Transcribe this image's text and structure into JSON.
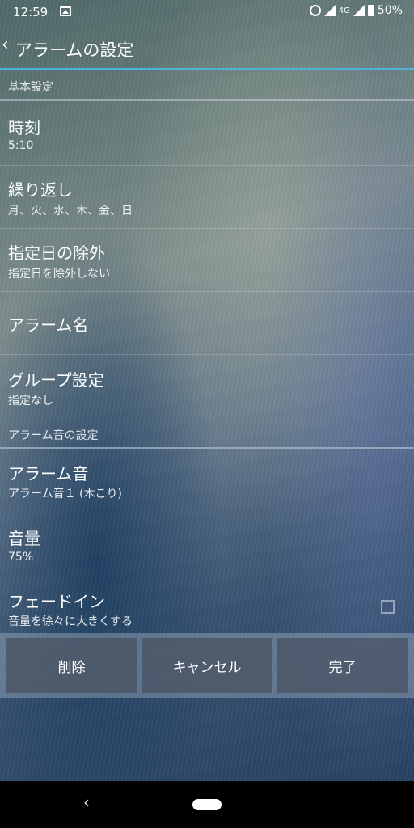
{
  "status_bar": {
    "time": "12:59",
    "network": "4G",
    "battery": "50%"
  },
  "toolbar": {
    "title": "アラームの設定"
  },
  "sections": {
    "basic": "基本設定",
    "sound": "アラーム音の設定"
  },
  "settings": {
    "time": {
      "label": "時刻",
      "value": "5:10"
    },
    "repeat": {
      "label": "繰り返し",
      "value": "月、火、水、木、金、日"
    },
    "exclude": {
      "label": "指定日の除外",
      "value": "指定日を除外しない"
    },
    "alarm_name": {
      "label": "アラーム名"
    },
    "group": {
      "label": "グループ設定",
      "value": "指定なし"
    },
    "alarm_sound": {
      "label": "アラーム音",
      "value": "アラーム音１ (木こり)"
    },
    "volume": {
      "label": "音量",
      "value": "75%"
    },
    "fade_in": {
      "label": "フェードイン",
      "value": "音量を徐々に大きくする",
      "checked": false
    }
  },
  "buttons": {
    "delete": "削除",
    "cancel": "キャンセル",
    "done": "完了"
  },
  "nav": {
    "back": "‹"
  },
  "colors": {
    "accent": "#4fb3d9"
  }
}
